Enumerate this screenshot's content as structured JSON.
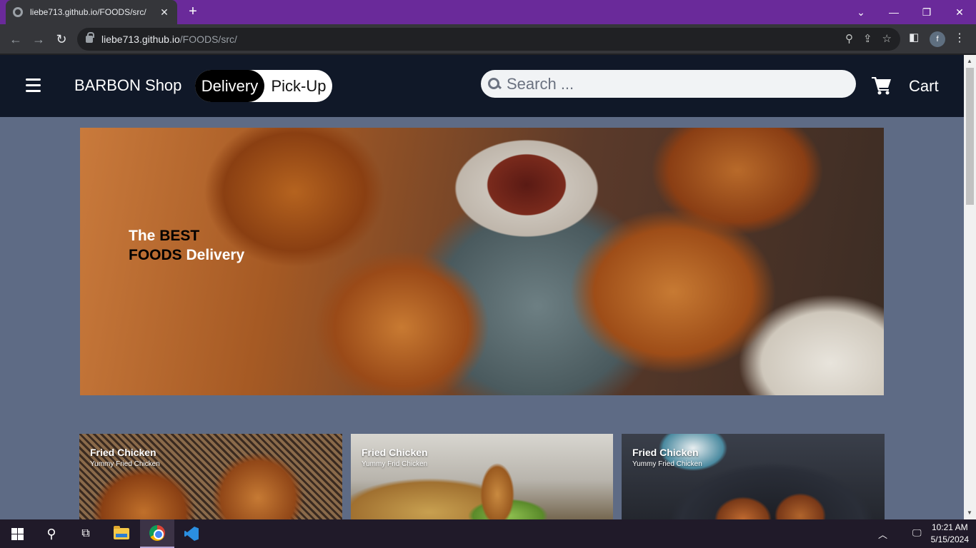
{
  "browser": {
    "tab_title": "liebe713.github.io/FOODS/src/",
    "url_host": "liebe713.github.io",
    "url_path": "/FOODS/src/",
    "profile_initial": "f"
  },
  "site": {
    "brand": "BARBON Shop",
    "toggle": {
      "delivery": "Delivery",
      "pickup": "Pick-Up",
      "selected": "Delivery"
    },
    "search_placeholder": "Search ...",
    "cart_label": "Cart"
  },
  "hero": {
    "line1_a": "The",
    "line1_b": "BEST",
    "line2_a": "FOODS",
    "line2_b": "Delivery"
  },
  "cards": [
    {
      "title": "Fried Chicken",
      "subtitle": "Yummy Fried Chicken"
    },
    {
      "title": "Fried Chicken",
      "subtitle": "Yummy Frid Chicken"
    },
    {
      "title": "Fried Chicken",
      "subtitle": "Yummy Fried Chicken"
    }
  ],
  "taskbar": {
    "time": "10:21 AM",
    "date": "5/15/2024"
  },
  "colors": {
    "tabstrip": "#6a2a9a",
    "site_header": "#101828",
    "page_bg": "#5e6b85"
  }
}
